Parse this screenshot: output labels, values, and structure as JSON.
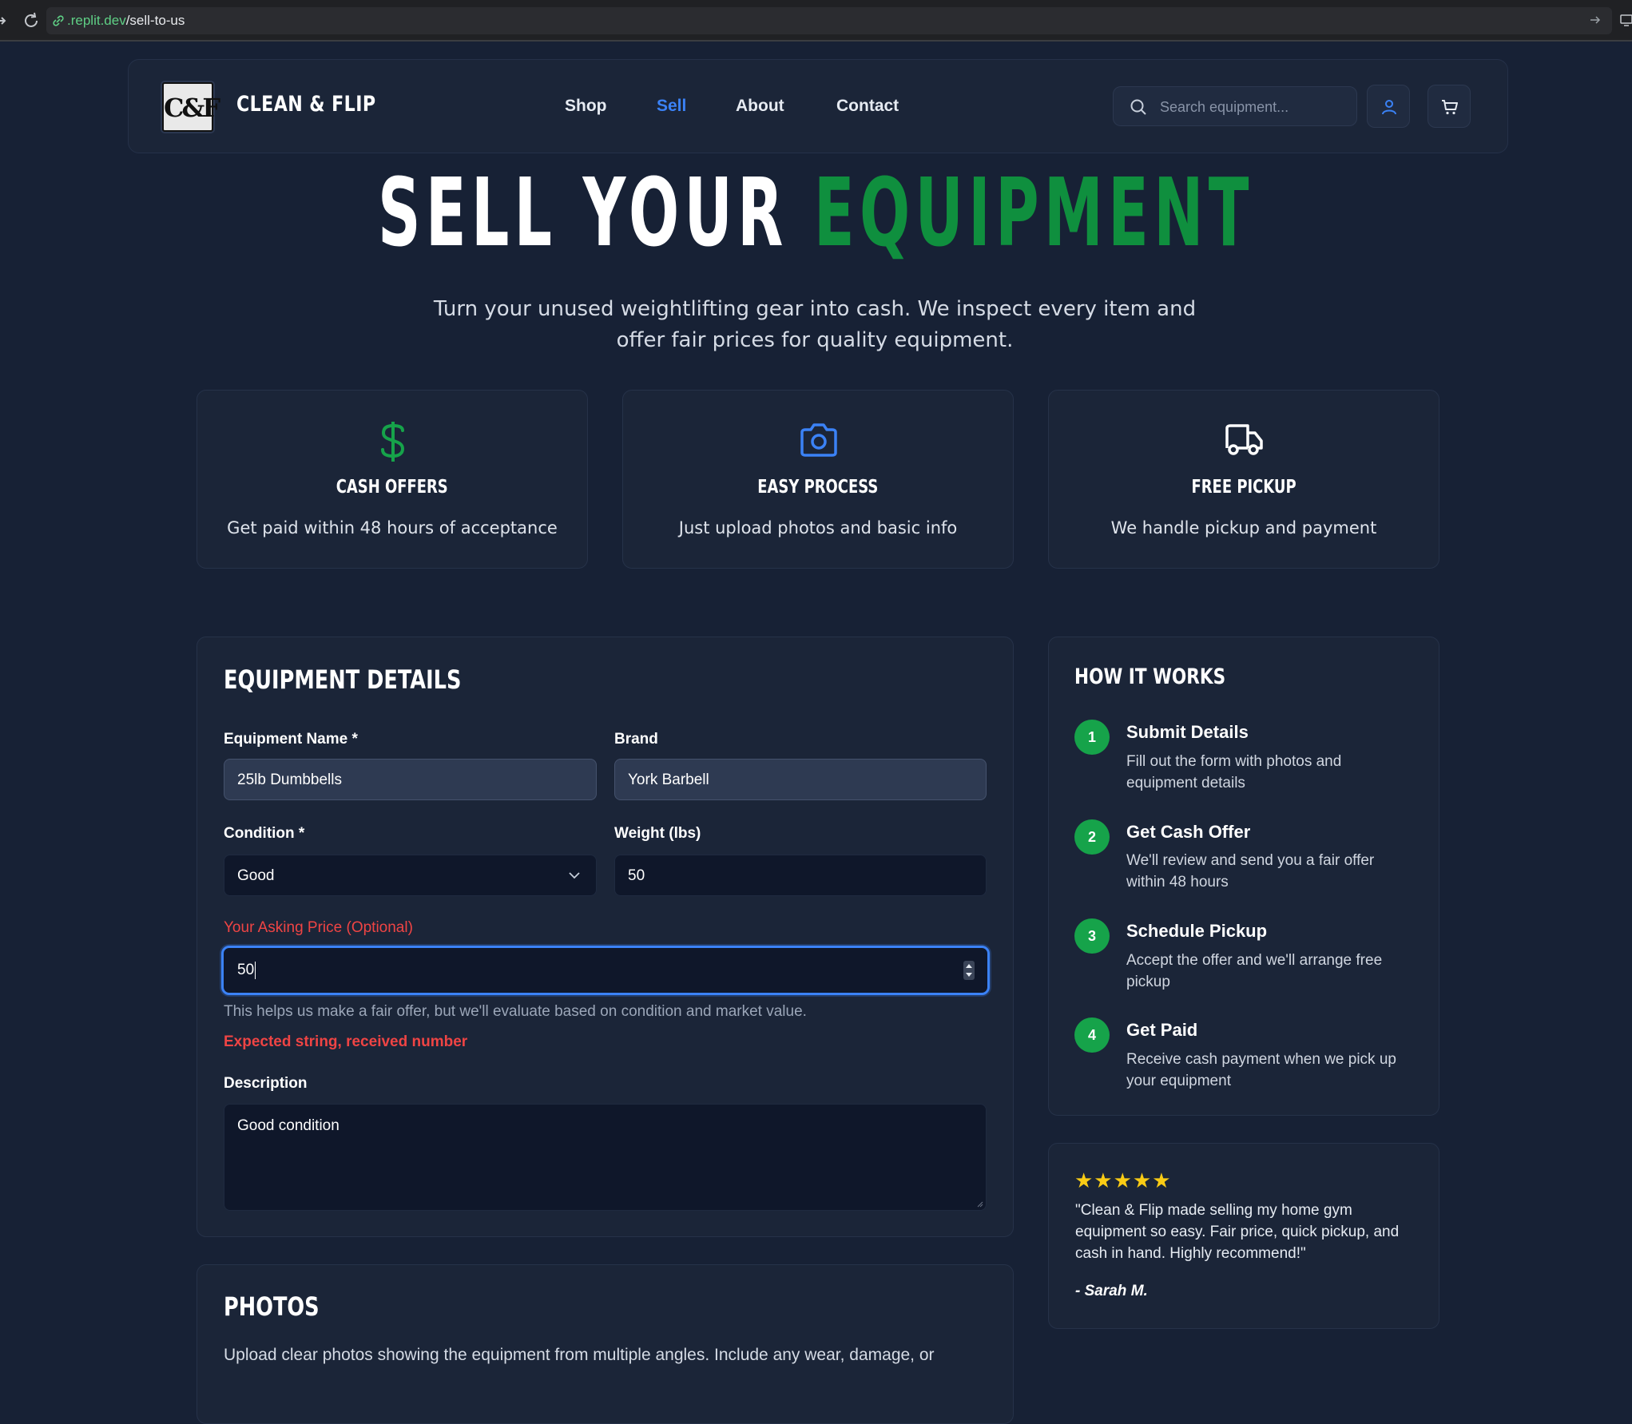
{
  "browser": {
    "url_host": ".replit.dev",
    "url_path": "/sell-to-us"
  },
  "header": {
    "logo_text": "C&F",
    "brand": "CLEAN & FLIP",
    "nav": [
      {
        "label": "Shop",
        "active": false
      },
      {
        "label": "Sell",
        "active": true
      },
      {
        "label": "About",
        "active": false
      },
      {
        "label": "Contact",
        "active": false
      }
    ],
    "search_placeholder": "Search equipment..."
  },
  "hero": {
    "title_white": "SELL YOUR",
    "title_green": "EQUIPMENT",
    "subtitle": "Turn your unused weightlifting gear into cash. We inspect every item and offer fair prices for quality equipment."
  },
  "features": [
    {
      "icon": "dollar-icon",
      "title": "CASH OFFERS",
      "text": "Get paid within 48 hours of acceptance"
    },
    {
      "icon": "camera-icon",
      "title": "EASY PROCESS",
      "text": "Just upload photos and basic info"
    },
    {
      "icon": "truck-icon",
      "title": "FREE PICKUP",
      "text": "We handle pickup and payment"
    }
  ],
  "form": {
    "title": "EQUIPMENT DETAILS",
    "equipment_name_label": "Equipment Name *",
    "equipment_name_value": "25lb Dumbbells",
    "brand_label": "Brand",
    "brand_value": "York Barbell",
    "condition_label": "Condition *",
    "condition_value": "Good",
    "weight_label": "Weight (lbs)",
    "weight_value": "50",
    "price_label": "Your Asking Price (Optional)",
    "price_value": "50",
    "price_helper": "This helps us make a fair offer, but we'll evaluate based on condition and market value.",
    "price_error": "Expected string, received number",
    "description_label": "Description",
    "description_value": "Good condition"
  },
  "how_it_works": {
    "title": "HOW IT WORKS",
    "steps": [
      {
        "num": "1",
        "title": "Submit Details",
        "desc": "Fill out the form with photos and equipment details"
      },
      {
        "num": "2",
        "title": "Get Cash Offer",
        "desc": "We'll review and send you a fair offer within 48 hours"
      },
      {
        "num": "3",
        "title": "Schedule Pickup",
        "desc": "Accept the offer and we'll arrange free pickup"
      },
      {
        "num": "4",
        "title": "Get Paid",
        "desc": "Receive cash payment when we pick up your equipment"
      }
    ]
  },
  "testimonial": {
    "stars": "★★★★★",
    "rating": 5,
    "quote": "\"Clean & Flip made selling my home gym equipment so easy. Fair price, quick pickup, and cash in hand. Highly recommend!\"",
    "author": "- Sarah M."
  },
  "photos": {
    "title": "PHOTOS",
    "text": "Upload clear photos showing the equipment from multiple angles. Include any wear, damage, or"
  },
  "colors": {
    "background": "#172135",
    "accent_blue": "#3b82f6",
    "accent_green": "#0f8f3e",
    "step_green": "#16a34a",
    "error_red": "#ef4444",
    "star_yellow": "#facc15"
  }
}
